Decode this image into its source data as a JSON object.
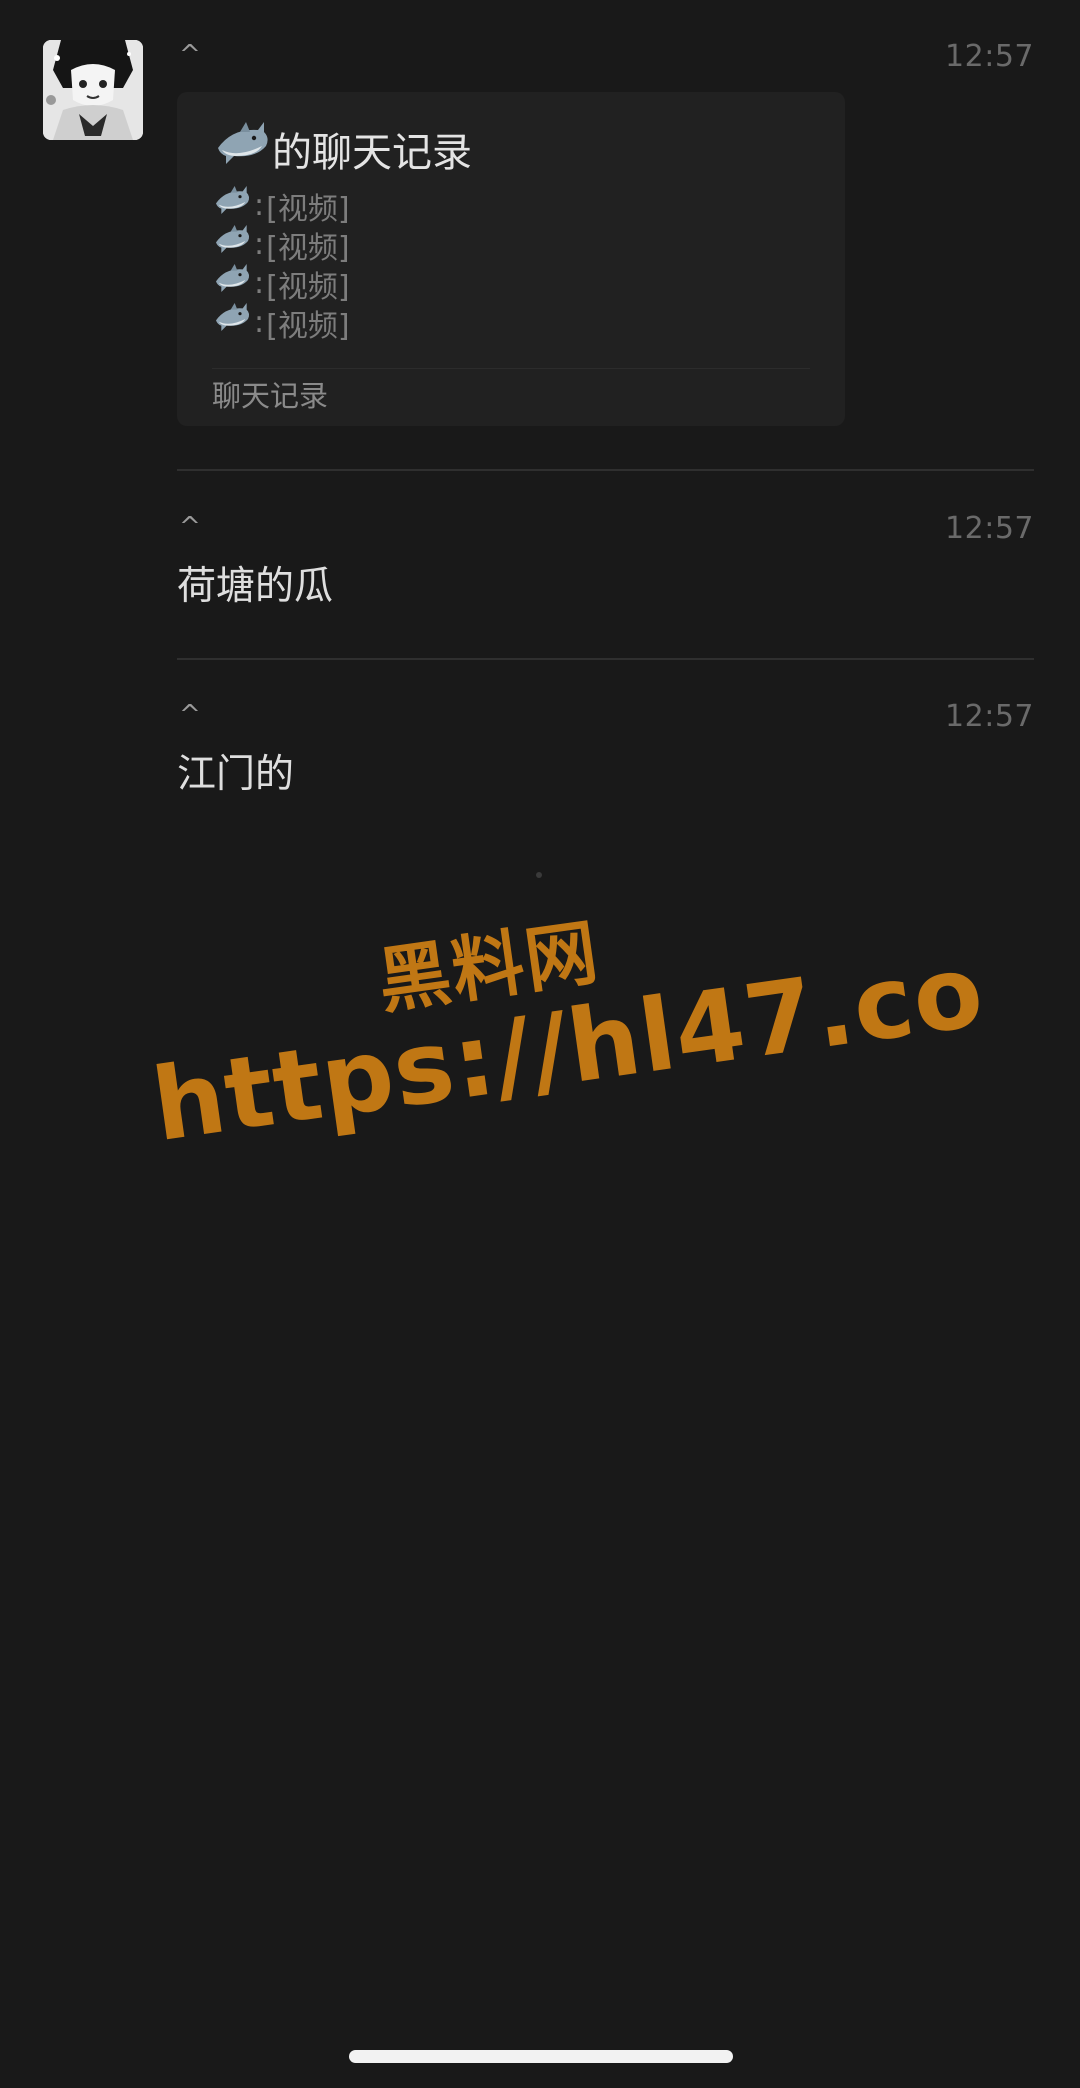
{
  "avatar": {
    "icon": "anime-avatar-icon"
  },
  "messages": [
    {
      "sender": "^",
      "time": "12:57",
      "type": "chat-history-card",
      "card": {
        "title_suffix": "的聊天记录",
        "title_icon": "shark-icon",
        "lines": [
          {
            "sep": ":",
            "content": "[视频]"
          },
          {
            "sep": ":",
            "content": "[视频]"
          },
          {
            "sep": ":",
            "content": "[视频]"
          },
          {
            "sep": ":",
            "content": "[视频]"
          }
        ],
        "footer": "聊天记录"
      }
    },
    {
      "sender": "^",
      "time": "12:57",
      "type": "text",
      "text": "荷塘的瓜"
    },
    {
      "sender": "^",
      "time": "12:57",
      "type": "text",
      "text": "江门的"
    }
  ],
  "watermark": {
    "line1": "黑料网",
    "line2": "https://hl47.co",
    "color": "#c07714"
  },
  "colors": {
    "background": "#191919",
    "card": "#212121",
    "divider": "#2f2f2f"
  }
}
